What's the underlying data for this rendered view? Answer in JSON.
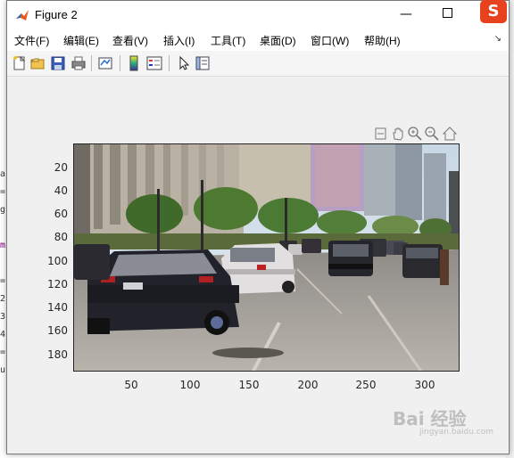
{
  "window": {
    "title": "Figure 2"
  },
  "menu": {
    "items": [
      "文件(F)",
      "编辑(E)",
      "查看(V)",
      "插入(I)",
      "工具(T)",
      "桌面(D)",
      "窗口(W)",
      "帮助(H)"
    ]
  },
  "toolbar": {
    "buttons": [
      "new-figure",
      "open-file",
      "save",
      "print",
      "link-plot",
      "insert-colorbar",
      "insert-legend",
      "edit-plot",
      "property-inspector"
    ]
  },
  "axes_toolbar": {
    "buttons": [
      "brush",
      "pan",
      "zoom-in",
      "zoom-out",
      "home"
    ]
  },
  "axes": {
    "yticks": [
      "20",
      "40",
      "60",
      "80",
      "100",
      "120",
      "140",
      "160",
      "180"
    ],
    "xticks": [
      "50",
      "100",
      "150",
      "200",
      "250",
      "300"
    ]
  },
  "image": {
    "description_icon": "street-scene-image"
  },
  "background_window": {
    "chars": [
      "a",
      "=",
      "g",
      "m",
      "=",
      "2",
      "3",
      "4",
      "=",
      "u"
    ]
  },
  "watermark": {
    "text": "Bai 经验",
    "subtext": "jingyan.baidu.com"
  },
  "sogou": {
    "label": "S"
  },
  "colors": {
    "accent": "#2b5797",
    "plot_border": "#262626"
  }
}
